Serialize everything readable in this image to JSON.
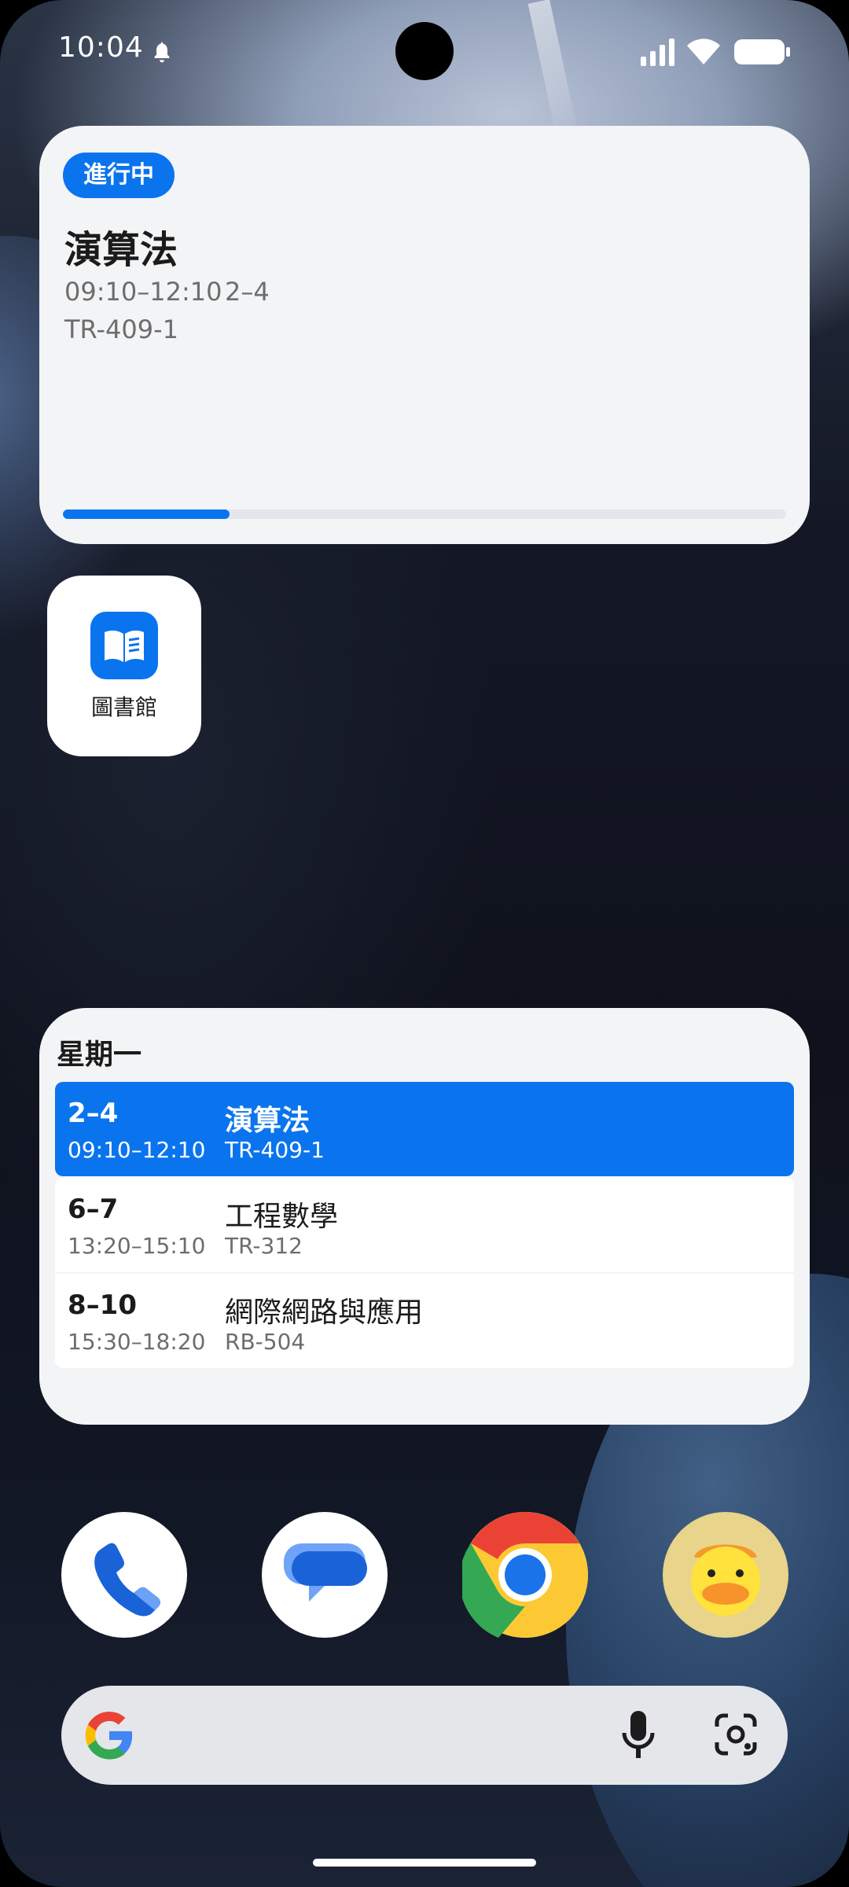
{
  "status_bar": {
    "time": "10:04",
    "icons": [
      "bell-icon",
      "signal-icon",
      "wifi-icon",
      "battery-icon"
    ]
  },
  "current_class_widget": {
    "badge": "進行中",
    "course": "演算法",
    "time_range": "09:10–12:10",
    "period": "2–4",
    "room": "TR-409-1",
    "progress_fraction": 0.23,
    "accent_color": "#0a74ef"
  },
  "library_app": {
    "label": "圖書館",
    "icon": "book-icon"
  },
  "schedule_widget": {
    "day": "星期一",
    "rows": [
      {
        "period": "2–4",
        "time": "09:10–12:10",
        "course": "演算法",
        "room": "TR-409-1",
        "active": true
      },
      {
        "period": "6–7",
        "time": "13:20–15:10",
        "course": "工程數學",
        "room": "TR-312",
        "active": false
      },
      {
        "period": "8–10",
        "time": "15:30–18:20",
        "course": "網際網路與應用",
        "room": "RB-504",
        "active": false
      }
    ]
  },
  "dock": {
    "apps": [
      "phone-icon",
      "messages-icon",
      "chrome-icon",
      "duck-avatar-icon"
    ]
  },
  "search_bar": {
    "icons": [
      "google-g-icon",
      "mic-icon",
      "lens-icon"
    ]
  }
}
